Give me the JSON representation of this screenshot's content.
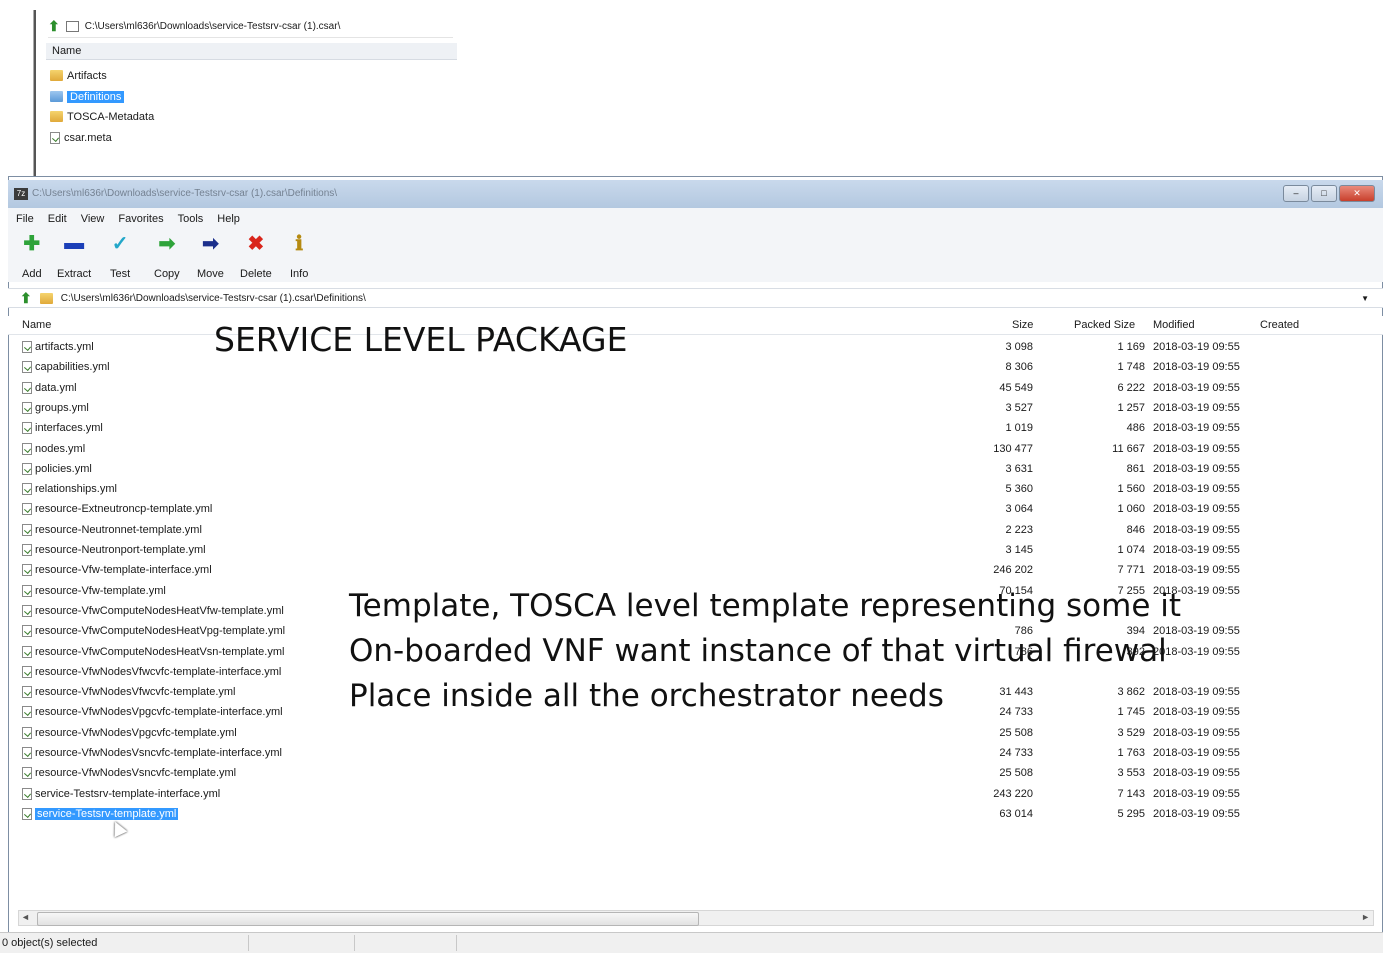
{
  "inset": {
    "path": "C:\\Users\\ml636r\\Downloads\\service-Testsrv-csar (1).csar\\",
    "column_name": "Name",
    "items": [
      {
        "label": "Artifacts",
        "icon": "folder-icon"
      },
      {
        "label": "Definitions",
        "icon": "folder-icon",
        "selected": true
      },
      {
        "label": "TOSCA-Metadata",
        "icon": "folder-icon"
      },
      {
        "label": "csar.meta",
        "icon": "file-icon"
      }
    ]
  },
  "window": {
    "title": "C:\\Users\\ml636r\\Downloads\\service-Testsrv-csar (1).csar\\Definitions\\"
  },
  "menu": [
    "File",
    "Edit",
    "View",
    "Favorites",
    "Tools",
    "Help"
  ],
  "toolbar": [
    {
      "label": "Add",
      "icon": "add-icon",
      "glyph": "✚",
      "color": "#2ea33a"
    },
    {
      "label": "Extract",
      "icon": "extract-icon",
      "glyph": "▬",
      "color": "#1b3fb8"
    },
    {
      "label": "Test",
      "icon": "test-icon",
      "glyph": "✓",
      "color": "#23a7c9"
    },
    {
      "label": "Copy",
      "icon": "copy-icon",
      "glyph": "➡",
      "color": "#2ea33a"
    },
    {
      "label": "Move",
      "icon": "move-icon",
      "glyph": "➡",
      "color": "#1b2f8c"
    },
    {
      "label": "Delete",
      "icon": "delete-icon",
      "glyph": "✖",
      "color": "#d9261c"
    },
    {
      "label": "Info",
      "icon": "info-icon",
      "glyph": "ℹ",
      "color": "#b58a12"
    }
  ],
  "pathbar": {
    "path": "C:\\Users\\ml636r\\Downloads\\service-Testsrv-csar (1).csar\\Definitions\\"
  },
  "columns": {
    "name": "Name",
    "size": "Size",
    "packed": "Packed Size",
    "modified": "Modified",
    "created": "Created"
  },
  "files": [
    {
      "name": "artifacts.yml",
      "size": "3 098",
      "packed": "1 169",
      "modified": "2018-03-19 09:55"
    },
    {
      "name": "capabilities.yml",
      "size": "8 306",
      "packed": "1 748",
      "modified": "2018-03-19 09:55"
    },
    {
      "name": "data.yml",
      "size": "45 549",
      "packed": "6 222",
      "modified": "2018-03-19 09:55"
    },
    {
      "name": "groups.yml",
      "size": "3 527",
      "packed": "1 257",
      "modified": "2018-03-19 09:55"
    },
    {
      "name": "interfaces.yml",
      "size": "1 019",
      "packed": "486",
      "modified": "2018-03-19 09:55"
    },
    {
      "name": "nodes.yml",
      "size": "130 477",
      "packed": "11 667",
      "modified": "2018-03-19 09:55"
    },
    {
      "name": "policies.yml",
      "size": "3 631",
      "packed": "861",
      "modified": "2018-03-19 09:55"
    },
    {
      "name": "relationships.yml",
      "size": "5 360",
      "packed": "1 560",
      "modified": "2018-03-19 09:55"
    },
    {
      "name": "resource-Extneutroncp-template.yml",
      "size": "3 064",
      "packed": "1 060",
      "modified": "2018-03-19 09:55"
    },
    {
      "name": "resource-Neutronnet-template.yml",
      "size": "2 223",
      "packed": "846",
      "modified": "2018-03-19 09:55"
    },
    {
      "name": "resource-Neutronport-template.yml",
      "size": "3 145",
      "packed": "1 074",
      "modified": "2018-03-19 09:55"
    },
    {
      "name": "resource-Vfw-template-interface.yml",
      "size": "246 202",
      "packed": "7 771",
      "modified": "2018-03-19 09:55"
    },
    {
      "name": "resource-Vfw-template.yml",
      "size": "70 154",
      "packed": "7 255",
      "modified": "2018-03-19 09:55"
    },
    {
      "name": "resource-VfwComputeNodesHeatVfw-template.yml",
      "size": "",
      "packed": "",
      "modified": ""
    },
    {
      "name": "resource-VfwComputeNodesHeatVpg-template.yml",
      "size": "786",
      "packed": "394",
      "modified": "2018-03-19 09:55"
    },
    {
      "name": "resource-VfwComputeNodesHeatVsn-template.yml",
      "size": "786",
      "packed": "392",
      "modified": "2018-03-19 09:55"
    },
    {
      "name": "resource-VfwNodesVfwcvfc-template-interface.yml",
      "size": "",
      "packed": "",
      "modified": ""
    },
    {
      "name": "resource-VfwNodesVfwcvfc-template.yml",
      "size": "31 443",
      "packed": "3 862",
      "modified": "2018-03-19 09:55"
    },
    {
      "name": "resource-VfwNodesVpgcvfc-template-interface.yml",
      "size": "24 733",
      "packed": "1 745",
      "modified": "2018-03-19 09:55"
    },
    {
      "name": "resource-VfwNodesVpgcvfc-template.yml",
      "size": "25 508",
      "packed": "3 529",
      "modified": "2018-03-19 09:55"
    },
    {
      "name": "resource-VfwNodesVsncvfc-template-interface.yml",
      "size": "24 733",
      "packed": "1 763",
      "modified": "2018-03-19 09:55"
    },
    {
      "name": "resource-VfwNodesVsncvfc-template.yml",
      "size": "25 508",
      "packed": "3 553",
      "modified": "2018-03-19 09:55"
    },
    {
      "name": "service-Testsrv-template-interface.yml",
      "size": "243 220",
      "packed": "7 143",
      "modified": "2018-03-19 09:55"
    },
    {
      "name": "service-Testsrv-template.yml",
      "size": "63 014",
      "packed": "5 295",
      "modified": "2018-03-19 09:55",
      "selected": true
    }
  ],
  "status": {
    "text": "0 object(s) selected"
  },
  "overlay": {
    "title": "SERVICE LEVEL PACKAGE",
    "lines": [
      "Template, TOSCA level template representing some it",
      "On-boarded VNF want instance of that virtual firewal",
      "Place inside all the orchestrator needs"
    ]
  }
}
